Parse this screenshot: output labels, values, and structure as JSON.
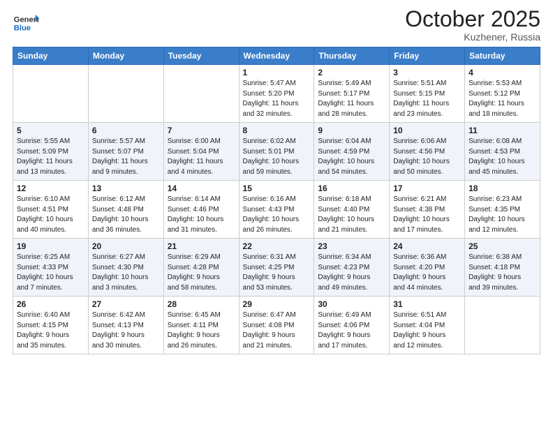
{
  "header": {
    "logo_general": "General",
    "logo_blue": "Blue",
    "month": "October 2025",
    "location": "Kuzhener, Russia"
  },
  "weekdays": [
    "Sunday",
    "Monday",
    "Tuesday",
    "Wednesday",
    "Thursday",
    "Friday",
    "Saturday"
  ],
  "weeks": [
    [
      {
        "day": "",
        "info": ""
      },
      {
        "day": "",
        "info": ""
      },
      {
        "day": "",
        "info": ""
      },
      {
        "day": "1",
        "info": "Sunrise: 5:47 AM\nSunset: 5:20 PM\nDaylight: 11 hours\nand 32 minutes."
      },
      {
        "day": "2",
        "info": "Sunrise: 5:49 AM\nSunset: 5:17 PM\nDaylight: 11 hours\nand 28 minutes."
      },
      {
        "day": "3",
        "info": "Sunrise: 5:51 AM\nSunset: 5:15 PM\nDaylight: 11 hours\nand 23 minutes."
      },
      {
        "day": "4",
        "info": "Sunrise: 5:53 AM\nSunset: 5:12 PM\nDaylight: 11 hours\nand 18 minutes."
      }
    ],
    [
      {
        "day": "5",
        "info": "Sunrise: 5:55 AM\nSunset: 5:09 PM\nDaylight: 11 hours\nand 13 minutes."
      },
      {
        "day": "6",
        "info": "Sunrise: 5:57 AM\nSunset: 5:07 PM\nDaylight: 11 hours\nand 9 minutes."
      },
      {
        "day": "7",
        "info": "Sunrise: 6:00 AM\nSunset: 5:04 PM\nDaylight: 11 hours\nand 4 minutes."
      },
      {
        "day": "8",
        "info": "Sunrise: 6:02 AM\nSunset: 5:01 PM\nDaylight: 10 hours\nand 59 minutes."
      },
      {
        "day": "9",
        "info": "Sunrise: 6:04 AM\nSunset: 4:59 PM\nDaylight: 10 hours\nand 54 minutes."
      },
      {
        "day": "10",
        "info": "Sunrise: 6:06 AM\nSunset: 4:56 PM\nDaylight: 10 hours\nand 50 minutes."
      },
      {
        "day": "11",
        "info": "Sunrise: 6:08 AM\nSunset: 4:53 PM\nDaylight: 10 hours\nand 45 minutes."
      }
    ],
    [
      {
        "day": "12",
        "info": "Sunrise: 6:10 AM\nSunset: 4:51 PM\nDaylight: 10 hours\nand 40 minutes."
      },
      {
        "day": "13",
        "info": "Sunrise: 6:12 AM\nSunset: 4:48 PM\nDaylight: 10 hours\nand 36 minutes."
      },
      {
        "day": "14",
        "info": "Sunrise: 6:14 AM\nSunset: 4:46 PM\nDaylight: 10 hours\nand 31 minutes."
      },
      {
        "day": "15",
        "info": "Sunrise: 6:16 AM\nSunset: 4:43 PM\nDaylight: 10 hours\nand 26 minutes."
      },
      {
        "day": "16",
        "info": "Sunrise: 6:18 AM\nSunset: 4:40 PM\nDaylight: 10 hours\nand 21 minutes."
      },
      {
        "day": "17",
        "info": "Sunrise: 6:21 AM\nSunset: 4:38 PM\nDaylight: 10 hours\nand 17 minutes."
      },
      {
        "day": "18",
        "info": "Sunrise: 6:23 AM\nSunset: 4:35 PM\nDaylight: 10 hours\nand 12 minutes."
      }
    ],
    [
      {
        "day": "19",
        "info": "Sunrise: 6:25 AM\nSunset: 4:33 PM\nDaylight: 10 hours\nand 7 minutes."
      },
      {
        "day": "20",
        "info": "Sunrise: 6:27 AM\nSunset: 4:30 PM\nDaylight: 10 hours\nand 3 minutes."
      },
      {
        "day": "21",
        "info": "Sunrise: 6:29 AM\nSunset: 4:28 PM\nDaylight: 9 hours\nand 58 minutes."
      },
      {
        "day": "22",
        "info": "Sunrise: 6:31 AM\nSunset: 4:25 PM\nDaylight: 9 hours\nand 53 minutes."
      },
      {
        "day": "23",
        "info": "Sunrise: 6:34 AM\nSunset: 4:23 PM\nDaylight: 9 hours\nand 49 minutes."
      },
      {
        "day": "24",
        "info": "Sunrise: 6:36 AM\nSunset: 4:20 PM\nDaylight: 9 hours\nand 44 minutes."
      },
      {
        "day": "25",
        "info": "Sunrise: 6:38 AM\nSunset: 4:18 PM\nDaylight: 9 hours\nand 39 minutes."
      }
    ],
    [
      {
        "day": "26",
        "info": "Sunrise: 6:40 AM\nSunset: 4:15 PM\nDaylight: 9 hours\nand 35 minutes."
      },
      {
        "day": "27",
        "info": "Sunrise: 6:42 AM\nSunset: 4:13 PM\nDaylight: 9 hours\nand 30 minutes."
      },
      {
        "day": "28",
        "info": "Sunrise: 6:45 AM\nSunset: 4:11 PM\nDaylight: 9 hours\nand 26 minutes."
      },
      {
        "day": "29",
        "info": "Sunrise: 6:47 AM\nSunset: 4:08 PM\nDaylight: 9 hours\nand 21 minutes."
      },
      {
        "day": "30",
        "info": "Sunrise: 6:49 AM\nSunset: 4:06 PM\nDaylight: 9 hours\nand 17 minutes."
      },
      {
        "day": "31",
        "info": "Sunrise: 6:51 AM\nSunset: 4:04 PM\nDaylight: 9 hours\nand 12 minutes."
      },
      {
        "day": "",
        "info": ""
      }
    ]
  ]
}
